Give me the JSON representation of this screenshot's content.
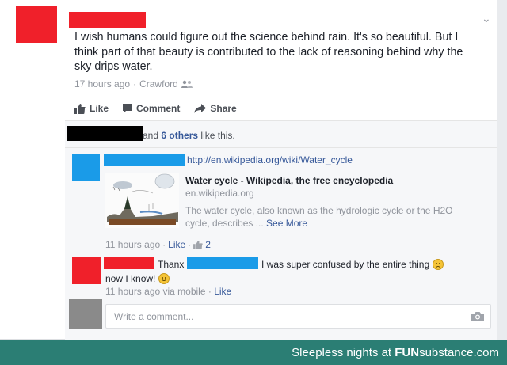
{
  "post": {
    "text": "I wish humans could figure out the science behind rain. It's so beautiful. But I think part of that beauty is contributed to the lack of reasoning behind why the sky drips water.",
    "time": "17 hours ago",
    "separator": "·",
    "location": "Crawford"
  },
  "actions": {
    "like": "Like",
    "comment": "Comment",
    "share": "Share"
  },
  "likes": {
    "prefix": "and",
    "others": "6 others",
    "suffix": "like this."
  },
  "comment1": {
    "link": "http://en.wikipedia.org/wiki/Water_cycle",
    "preview_title": "Water cycle - Wikipedia, the free encyclopedia",
    "preview_domain": "en.wikipedia.org",
    "preview_desc": "The water cycle, also known as the hydrologic cycle or the H2O cycle, describes ...",
    "see_more": "See More",
    "time": "11 hours ago",
    "like": "Like",
    "like_count": "2"
  },
  "comment2": {
    "thanx": "Thanx",
    "rest": "I was super confused by the entire thing",
    "line2": "now I know!",
    "time": "11 hours ago via mobile",
    "like": "Like"
  },
  "composer": {
    "placeholder": "Write a comment..."
  },
  "footer": {
    "prefix": "Sleepless nights at",
    "brand_a": "FUN",
    "brand_b": "substance",
    "brand_c": ".com"
  },
  "colors": {
    "link": "#365899",
    "footer_bg": "#2b7e74",
    "redact_red": "#f0202a",
    "redact_blue": "#1a9be8"
  }
}
